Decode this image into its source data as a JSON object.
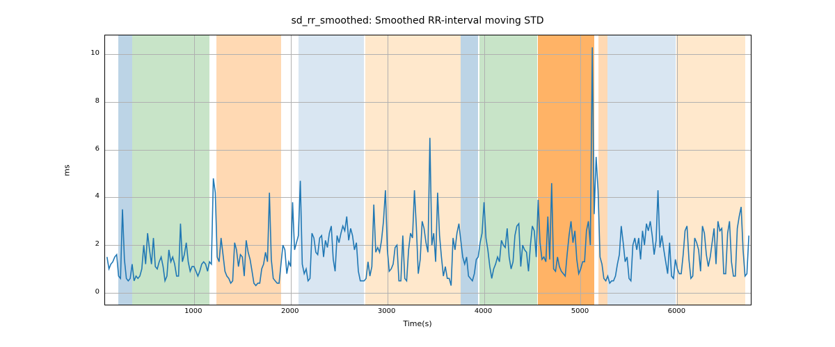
{
  "chart_data": {
    "type": "line",
    "title": "sd_rr_smoothed: Smoothed RR-interval moving STD",
    "xlabel": "Time(s)",
    "ylabel": "ms",
    "xlim": [
      80,
      6760
    ],
    "ylim": [
      -0.5,
      10.8
    ],
    "xticks": [
      1000,
      2000,
      3000,
      4000,
      5000,
      6000
    ],
    "yticks": [
      0,
      2,
      4,
      6,
      8,
      10
    ],
    "line_color": "#1f77b4",
    "regions": [
      {
        "start": 220,
        "end": 360,
        "color": "#bcd4e6"
      },
      {
        "start": 360,
        "end": 1160,
        "color": "#c8e4c8"
      },
      {
        "start": 1230,
        "end": 1900,
        "color": "#ffd9b3"
      },
      {
        "start": 2080,
        "end": 2760,
        "color": "#d9e6f2"
      },
      {
        "start": 2770,
        "end": 3760,
        "color": "#ffe8cc"
      },
      {
        "start": 3760,
        "end": 3940,
        "color": "#bcd4e6"
      },
      {
        "start": 3950,
        "end": 4550,
        "color": "#c8e4c8"
      },
      {
        "start": 4560,
        "end": 5140,
        "color": "#ffb366"
      },
      {
        "start": 5180,
        "end": 5280,
        "color": "#ffd9b3"
      },
      {
        "start": 5280,
        "end": 5980,
        "color": "#d9e6f2"
      },
      {
        "start": 5990,
        "end": 6700,
        "color": "#ffe8cc"
      }
    ],
    "series": [
      {
        "name": "sd_rr_smoothed",
        "x": [
          100,
          120,
          140,
          160,
          180,
          200,
          220,
          240,
          260,
          280,
          300,
          320,
          340,
          360,
          380,
          400,
          420,
          440,
          460,
          480,
          500,
          520,
          540,
          560,
          580,
          600,
          620,
          640,
          660,
          680,
          700,
          720,
          740,
          760,
          780,
          800,
          820,
          840,
          860,
          880,
          900,
          920,
          940,
          960,
          980,
          1000,
          1020,
          1040,
          1060,
          1080,
          1100,
          1120,
          1140,
          1160,
          1180,
          1200,
          1220,
          1240,
          1260,
          1280,
          1300,
          1320,
          1340,
          1360,
          1380,
          1400,
          1420,
          1440,
          1460,
          1480,
          1500,
          1520,
          1540,
          1560,
          1580,
          1600,
          1620,
          1640,
          1660,
          1680,
          1700,
          1720,
          1740,
          1760,
          1780,
          1800,
          1820,
          1840,
          1860,
          1880,
          1900,
          1920,
          1940,
          1960,
          1980,
          2000,
          2020,
          2040,
          2060,
          2080,
          2100,
          2120,
          2140,
          2160,
          2180,
          2200,
          2220,
          2240,
          2260,
          2280,
          2300,
          2320,
          2340,
          2360,
          2380,
          2400,
          2420,
          2440,
          2460,
          2480,
          2500,
          2520,
          2540,
          2560,
          2580,
          2600,
          2620,
          2640,
          2660,
          2680,
          2700,
          2720,
          2740,
          2760,
          2780,
          2800,
          2820,
          2840,
          2860,
          2880,
          2900,
          2920,
          2940,
          2960,
          2980,
          3000,
          3020,
          3040,
          3060,
          3080,
          3100,
          3120,
          3140,
          3160,
          3180,
          3200,
          3220,
          3240,
          3260,
          3280,
          3300,
          3320,
          3340,
          3360,
          3380,
          3400,
          3420,
          3440,
          3460,
          3480,
          3500,
          3520,
          3540,
          3560,
          3580,
          3600,
          3620,
          3640,
          3660,
          3680,
          3700,
          3720,
          3740,
          3760,
          3780,
          3800,
          3820,
          3840,
          3860,
          3880,
          3900,
          3920,
          3940,
          3960,
          3980,
          4000,
          4020,
          4040,
          4060,
          4080,
          4100,
          4120,
          4140,
          4160,
          4180,
          4200,
          4220,
          4240,
          4260,
          4280,
          4300,
          4320,
          4340,
          4360,
          4380,
          4400,
          4420,
          4440,
          4460,
          4480,
          4500,
          4520,
          4540,
          4560,
          4580,
          4600,
          4620,
          4640,
          4660,
          4680,
          4700,
          4720,
          4740,
          4760,
          4780,
          4800,
          4820,
          4840,
          4860,
          4880,
          4900,
          4920,
          4940,
          4960,
          4980,
          5000,
          5020,
          5040,
          5060,
          5080,
          5100,
          5120,
          5140,
          5160,
          5180,
          5200,
          5220,
          5240,
          5260,
          5280,
          5300,
          5320,
          5340,
          5360,
          5380,
          5400,
          5420,
          5440,
          5460,
          5480,
          5500,
          5520,
          5540,
          5560,
          5580,
          5600,
          5620,
          5640,
          5660,
          5680,
          5700,
          5720,
          5740,
          5760,
          5780,
          5800,
          5820,
          5840,
          5860,
          5880,
          5900,
          5920,
          5940,
          5960,
          5980,
          6000,
          6020,
          6040,
          6060,
          6080,
          6100,
          6120,
          6140,
          6160,
          6180,
          6200,
          6220,
          6240,
          6260,
          6280,
          6300,
          6320,
          6340,
          6360,
          6380,
          6400,
          6420,
          6440,
          6460,
          6480,
          6500,
          6520,
          6540,
          6560,
          6580,
          6600,
          6620,
          6640,
          6660,
          6680,
          6700,
          6720,
          6740
        ],
        "y": [
          1.5,
          1.0,
          1.2,
          1.3,
          1.5,
          1.6,
          0.7,
          0.6,
          3.5,
          1.4,
          0.6,
          0.5,
          0.6,
          1.2,
          0.5,
          0.7,
          0.6,
          0.7,
          1.0,
          2.0,
          1.2,
          2.5,
          1.8,
          1.2,
          2.3,
          1.1,
          1.0,
          1.3,
          1.5,
          1.1,
          0.5,
          0.7,
          1.8,
          1.3,
          1.5,
          1.2,
          0.7,
          0.7,
          2.9,
          1.3,
          1.6,
          2.1,
          1.3,
          0.9,
          1.1,
          1.1,
          0.9,
          0.7,
          0.9,
          1.2,
          1.3,
          1.2,
          0.9,
          1.3,
          1.2,
          4.8,
          4.2,
          1.5,
          1.3,
          2.3,
          1.6,
          0.9,
          0.7,
          0.6,
          0.4,
          0.5,
          2.1,
          1.8,
          1.1,
          1.6,
          1.5,
          0.7,
          2.2,
          1.7,
          1.4,
          0.9,
          0.4,
          0.3,
          0.4,
          0.4,
          1.0,
          1.2,
          1.7,
          1.3,
          4.2,
          1.4,
          0.6,
          0.5,
          0.4,
          0.4,
          1.2,
          2.0,
          1.8,
          0.8,
          1.3,
          1.1,
          3.8,
          1.8,
          2.1,
          2.4,
          4.7,
          1.2,
          0.8,
          1.0,
          0.5,
          0.6,
          2.5,
          2.3,
          1.7,
          1.6,
          2.3,
          2.4,
          1.5,
          2.2,
          1.9,
          2.5,
          2.8,
          1.4,
          0.9,
          2.4,
          2.1,
          2.5,
          2.8,
          2.6,
          3.2,
          2.2,
          2.7,
          2.4,
          1.8,
          2.1,
          0.9,
          0.5,
          0.5,
          0.5,
          0.6,
          1.3,
          0.7,
          1.1,
          3.7,
          1.7,
          1.9,
          1.7,
          2.2,
          3.0,
          4.3,
          1.8,
          0.9,
          1.0,
          1.2,
          1.9,
          2.0,
          0.5,
          0.5,
          2.4,
          0.6,
          0.5,
          1.8,
          2.5,
          2.3,
          4.3,
          2.8,
          0.8,
          1.4,
          3.0,
          2.7,
          2.1,
          1.7,
          6.5,
          2.0,
          2.5,
          1.3,
          4.2,
          2.4,
          1.5,
          0.7,
          1.1,
          0.6,
          0.6,
          0.3,
          2.3,
          1.8,
          2.5,
          2.9,
          2.2,
          1.5,
          1.2,
          1.5,
          0.7,
          0.6,
          0.5,
          0.8,
          1.4,
          1.5,
          2.1,
          2.5,
          3.8,
          2.3,
          1.8,
          1.1,
          0.6,
          1.0,
          1.2,
          1.5,
          1.3,
          2.2,
          2.0,
          1.9,
          2.7,
          1.5,
          1.0,
          1.3,
          2.4,
          2.8,
          2.9,
          1.1,
          2.0,
          1.8,
          1.7,
          0.9,
          2.0,
          2.8,
          2.6,
          1.5,
          3.9,
          2.1,
          1.4,
          1.5,
          1.3,
          3.2,
          1.4,
          4.6,
          1.0,
          0.9,
          1.5,
          1.1,
          0.9,
          0.8,
          0.7,
          1.6,
          2.4,
          3.0,
          2.1,
          2.6,
          1.4,
          0.8,
          1.0,
          1.3,
          1.3,
          2.6,
          3.0,
          2.0,
          10.3,
          3.3,
          5.7,
          4.3,
          1.5,
          1.2,
          0.6,
          0.5,
          0.7,
          0.4,
          0.5,
          0.5,
          0.7,
          1.2,
          1.6,
          2.8,
          2.1,
          1.3,
          1.5,
          0.6,
          0.5,
          2.0,
          2.3,
          1.8,
          2.3,
          1.4,
          2.6,
          2.0,
          2.9,
          2.6,
          3.0,
          2.4,
          1.6,
          2.2,
          4.3,
          1.9,
          2.4,
          1.8,
          1.3,
          0.8,
          2.1,
          0.7,
          0.6,
          1.4,
          1.0,
          0.8,
          0.8,
          1.6,
          2.6,
          2.8,
          1.4,
          0.6,
          0.7,
          2.3,
          2.1,
          1.8,
          0.9,
          2.8,
          2.5,
          1.6,
          1.1,
          1.5,
          2.1,
          2.7,
          1.2,
          3.0,
          2.6,
          2.7,
          0.8,
          0.8,
          2.5,
          3.0,
          1.3,
          0.7,
          0.7,
          2.7,
          3.2,
          3.6,
          1.8,
          0.7,
          0.8,
          2.4,
          2.1,
          2.5
        ]
      }
    ]
  }
}
